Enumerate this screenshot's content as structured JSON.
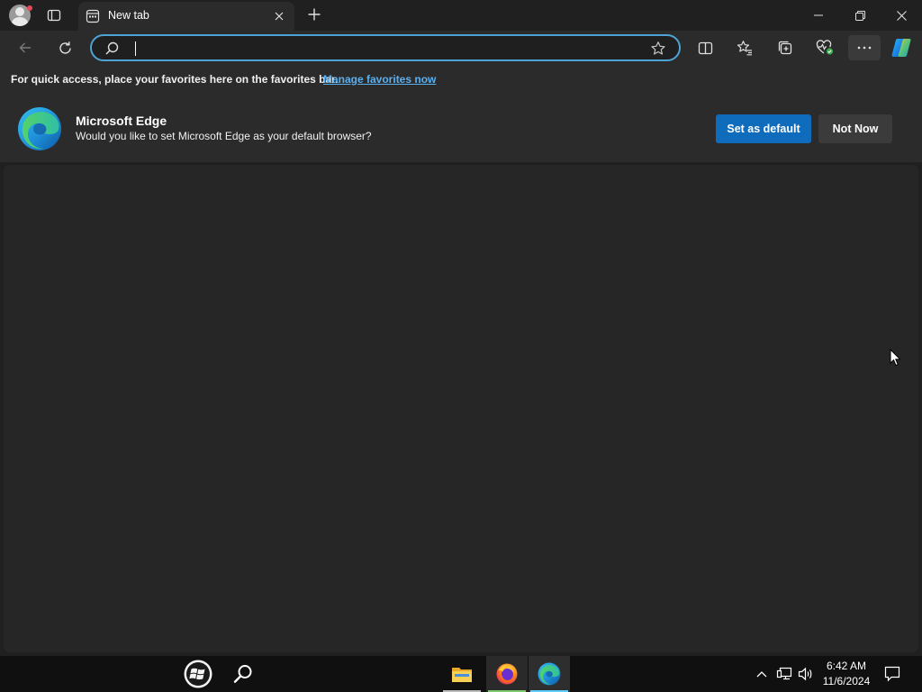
{
  "tab": {
    "title": "New tab"
  },
  "address": {
    "placeholder": "",
    "value": ""
  },
  "favorites_bar": {
    "message": "For quick access, place your favorites here on the favorites bar.",
    "link": "Manage favorites now"
  },
  "default_prompt": {
    "title": "Microsoft Edge",
    "text": "Would you like to set Microsoft Edge as your default browser?",
    "primary_button": "Set as default",
    "secondary_button": "Not Now"
  },
  "taskbar": {
    "apps": [
      "start-icon",
      "search-icon",
      "file-explorer-icon",
      "firefox-icon",
      "edge-icon"
    ],
    "time": "6:42 AM",
    "date": "11/6/2024"
  },
  "colors": {
    "accent": "#4ea3d4",
    "primary_button": "#0f6cbd",
    "link": "#5ab0f0",
    "background": "#202020",
    "content": "#262626"
  }
}
